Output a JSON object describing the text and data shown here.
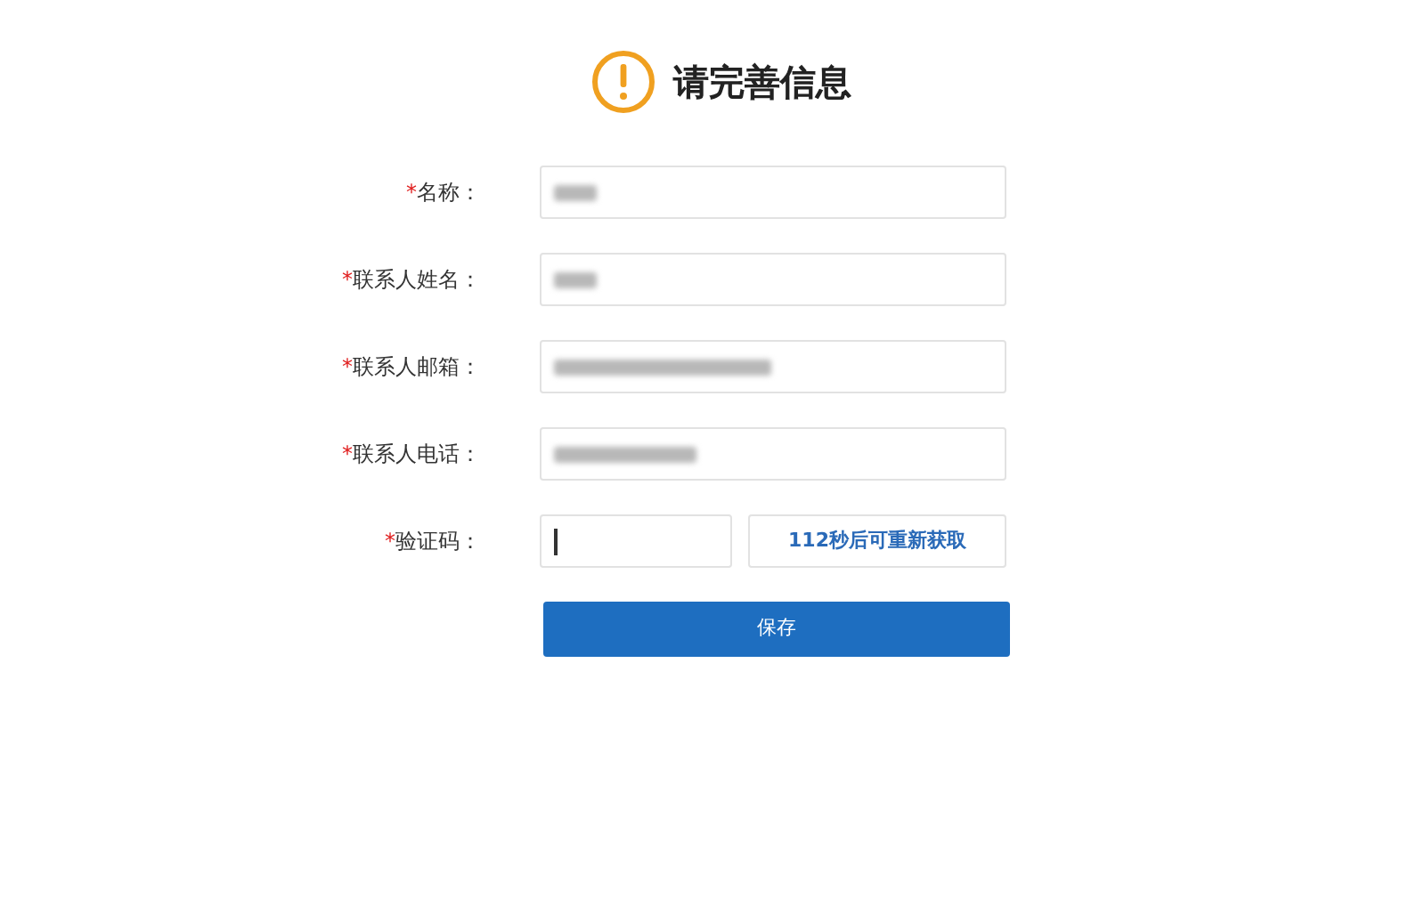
{
  "title": "请完善信息",
  "fields": [
    {
      "required_mark": "*",
      "label": "名称：",
      "kind": "short"
    },
    {
      "required_mark": "*",
      "label": "联系人姓名：",
      "kind": "short"
    },
    {
      "required_mark": "*",
      "label": "联系人邮箱：",
      "kind": "long"
    },
    {
      "required_mark": "*",
      "label": "联系人电话：",
      "kind": "medium"
    }
  ],
  "code": {
    "required_mark": "*",
    "label": "验证码：",
    "focused": true,
    "resend_button": "112秒后可重新获取"
  },
  "save_button": "保存"
}
